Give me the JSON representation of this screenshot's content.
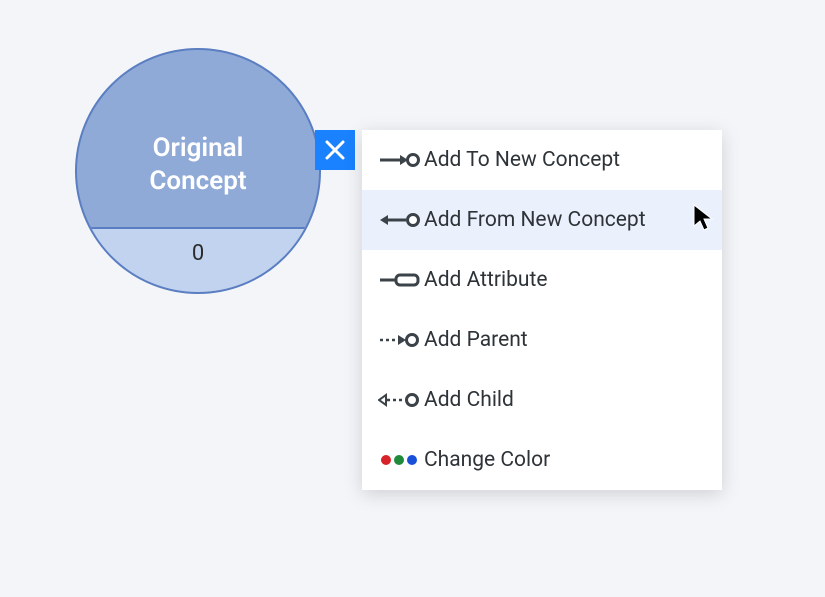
{
  "node": {
    "title_line1": "Original",
    "title_line2": "Concept",
    "count": "0"
  },
  "menu": {
    "items": [
      {
        "label": "Add To New Concept"
      },
      {
        "label": "Add From New Concept"
      },
      {
        "label": "Add Attribute"
      },
      {
        "label": "Add Parent"
      },
      {
        "label": "Add Child"
      },
      {
        "label": "Change Color"
      }
    ],
    "hovered_index": 1
  },
  "colors": {
    "node_fill": "#90aad8",
    "node_border": "#5a7ec1",
    "node_lower": "#c2d3ef",
    "close_btn": "#1a82ff",
    "hover_bg": "#eaf1fd"
  }
}
